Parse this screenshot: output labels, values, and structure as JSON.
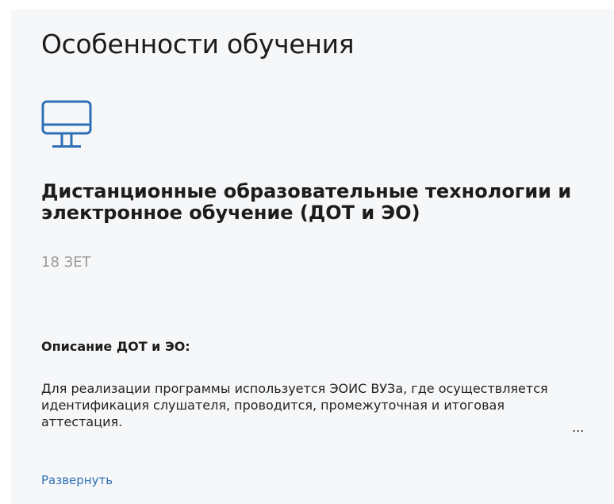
{
  "section": {
    "title": "Особенности обучения"
  },
  "format": {
    "icon": "monitor-icon",
    "icon_color": "#2f6fb6",
    "heading": "Дистанционные образовательные технологии и электронное обучение (ДОТ и ЭО)",
    "credits": "18 ЗЕТ"
  },
  "description": {
    "heading": "Описание ДОТ и ЭО:",
    "text": "Для реализации программы используется ЭОИС ВУЗа, где осуществляется идентификация слушателя, проводится, промежуточная и итоговая аттестация.",
    "ellipsis": "...",
    "expand_label": "Развернуть"
  },
  "colors": {
    "card_background": "#f6f7f9",
    "link": "#2f6fb6",
    "muted_text": "#9a9a9a"
  }
}
